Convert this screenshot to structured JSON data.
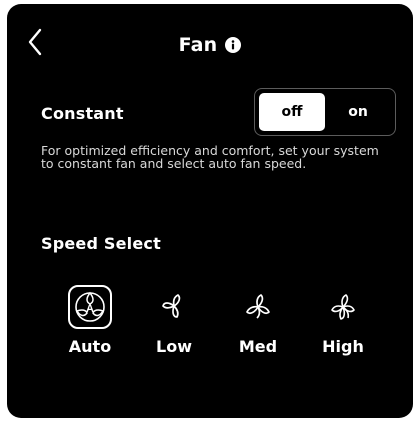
{
  "header": {
    "title": "Fan",
    "back_icon": "chevron-left-icon",
    "info_icon": "info-icon"
  },
  "constant": {
    "label": "Constant",
    "options": [
      "off",
      "on"
    ],
    "selected": "off",
    "description": "For optimized efficiency and comfort, set your system to constant fan and select auto fan speed."
  },
  "speed_select": {
    "label": "Speed Select",
    "selected": "Auto",
    "options": [
      {
        "label": "Auto",
        "icon": "fan-auto-icon"
      },
      {
        "label": "Low",
        "icon": "fan-low-icon"
      },
      {
        "label": "Med",
        "icon": "fan-med-icon"
      },
      {
        "label": "High",
        "icon": "fan-high-icon"
      }
    ]
  },
  "colors": {
    "background": "#000000",
    "text": "#ffffff",
    "toggle_selected_bg": "#ffffff",
    "toggle_border": "#5c5c5c"
  }
}
